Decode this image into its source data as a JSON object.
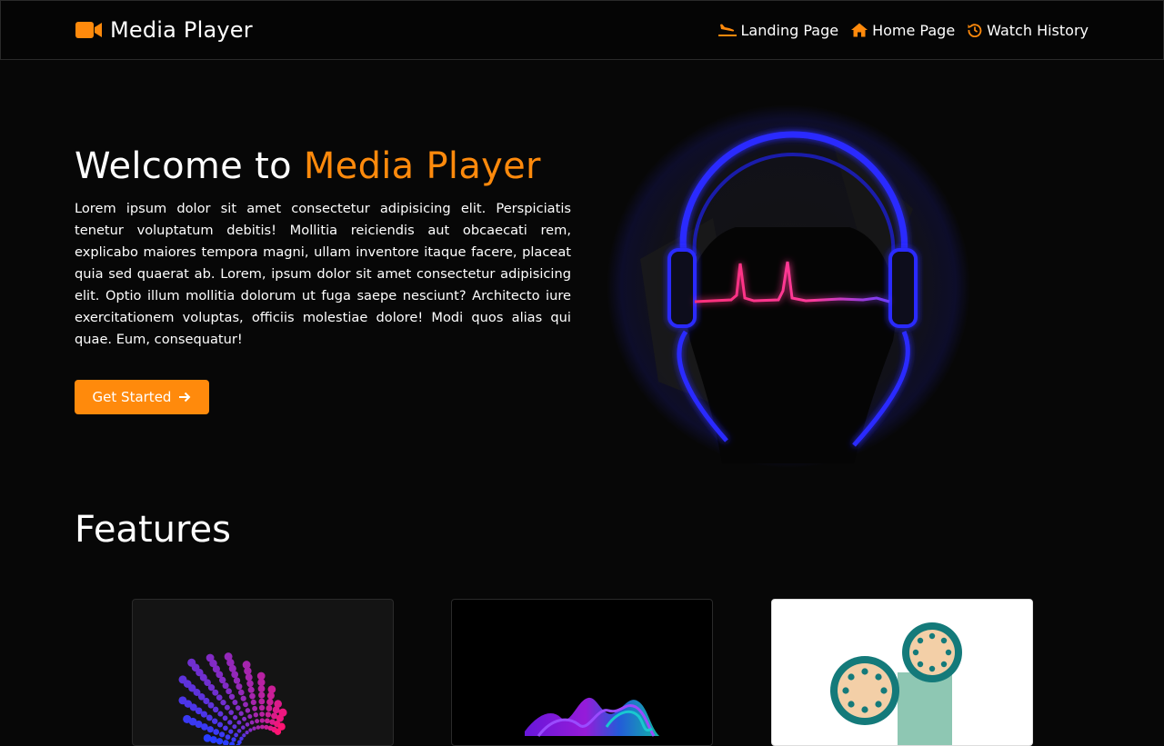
{
  "app": {
    "brand_name": "Media Player",
    "accent_color": "#ff8a0c",
    "brand_icon": "video-camera-icon"
  },
  "nav": {
    "links": [
      {
        "label": "Landing Page",
        "icon": "plane-landing-icon"
      },
      {
        "label": "Home Page",
        "icon": "home-icon"
      },
      {
        "label": "Watch History",
        "icon": "history-icon"
      }
    ]
  },
  "hero": {
    "title_prefix": "Welcome to",
    "title_accent": "Media Player",
    "description": "Lorem ipsum dolor sit amet consectetur adipisicing elit. Perspiciatis tenetur voluptatum debitis! Mollitia reiciendis aut obcaecati rem, explicabo maiores tempora magni, ullam inventore itaque facere, placeat quia sed quaerat ab. Lorem, ipsum dolor sit amet consectetur adipisicing elit. Optio illum mollitia dolorum ut fuga saepe nesciunt? Architecto iure exercitationem voluptas, officiis molestiae dolore! Modi quos alias qui quae. Eum, consequatur!",
    "cta_label": "Get Started",
    "cta_icon": "arrow-right-icon"
  },
  "features": {
    "title": "Features",
    "cards": [
      {
        "image": "radial-audio-bars-image"
      },
      {
        "image": "colorful-sound-wave-image"
      },
      {
        "image": "film-reel-image"
      }
    ]
  }
}
